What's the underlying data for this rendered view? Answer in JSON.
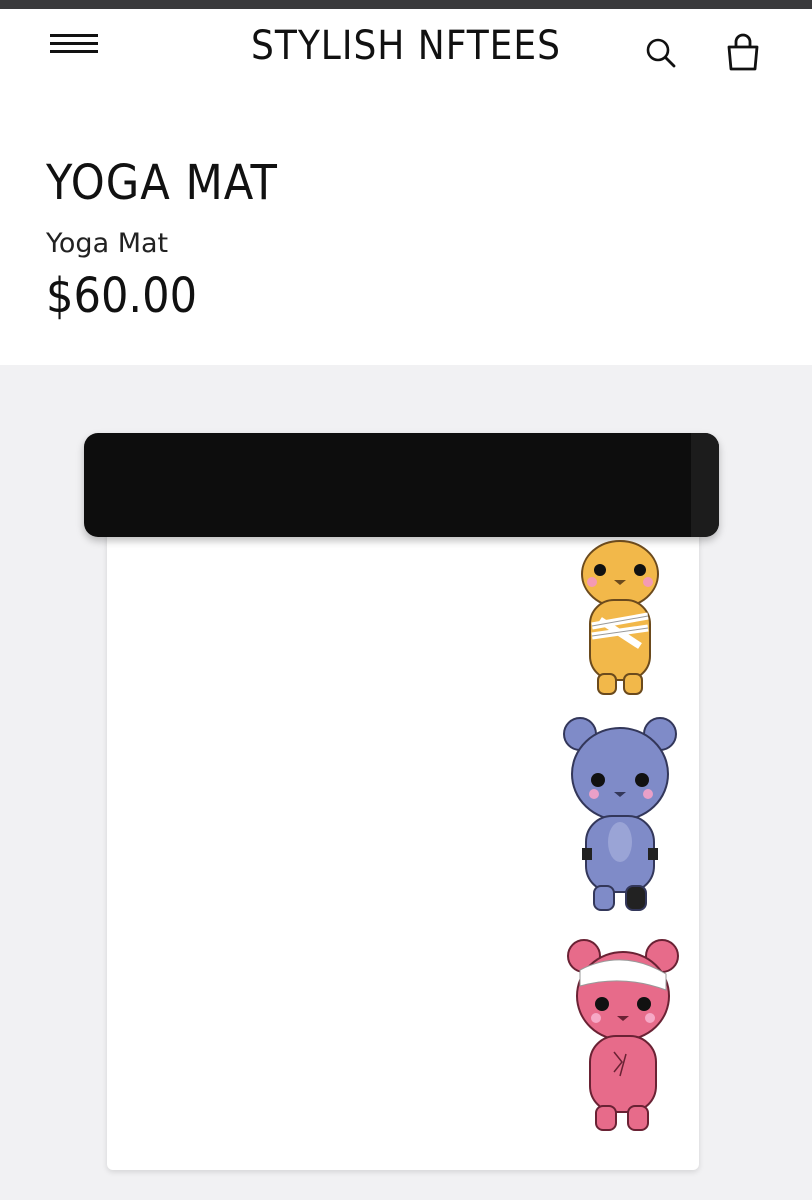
{
  "header": {
    "brand": "STYLISH NFTEES",
    "menu_icon": "hamburger-menu-icon",
    "search_icon": "search-icon",
    "cart_icon": "shopping-bag-icon"
  },
  "product": {
    "title": "YOGA MAT",
    "subtitle": "Yoga Mat",
    "price": "$60.00"
  },
  "gallery": {
    "image_subject": "black rolled yoga mat with three bear characters",
    "bear_colors": [
      "#f2b84a",
      "#7f8bc8",
      "#e76b8a"
    ]
  }
}
